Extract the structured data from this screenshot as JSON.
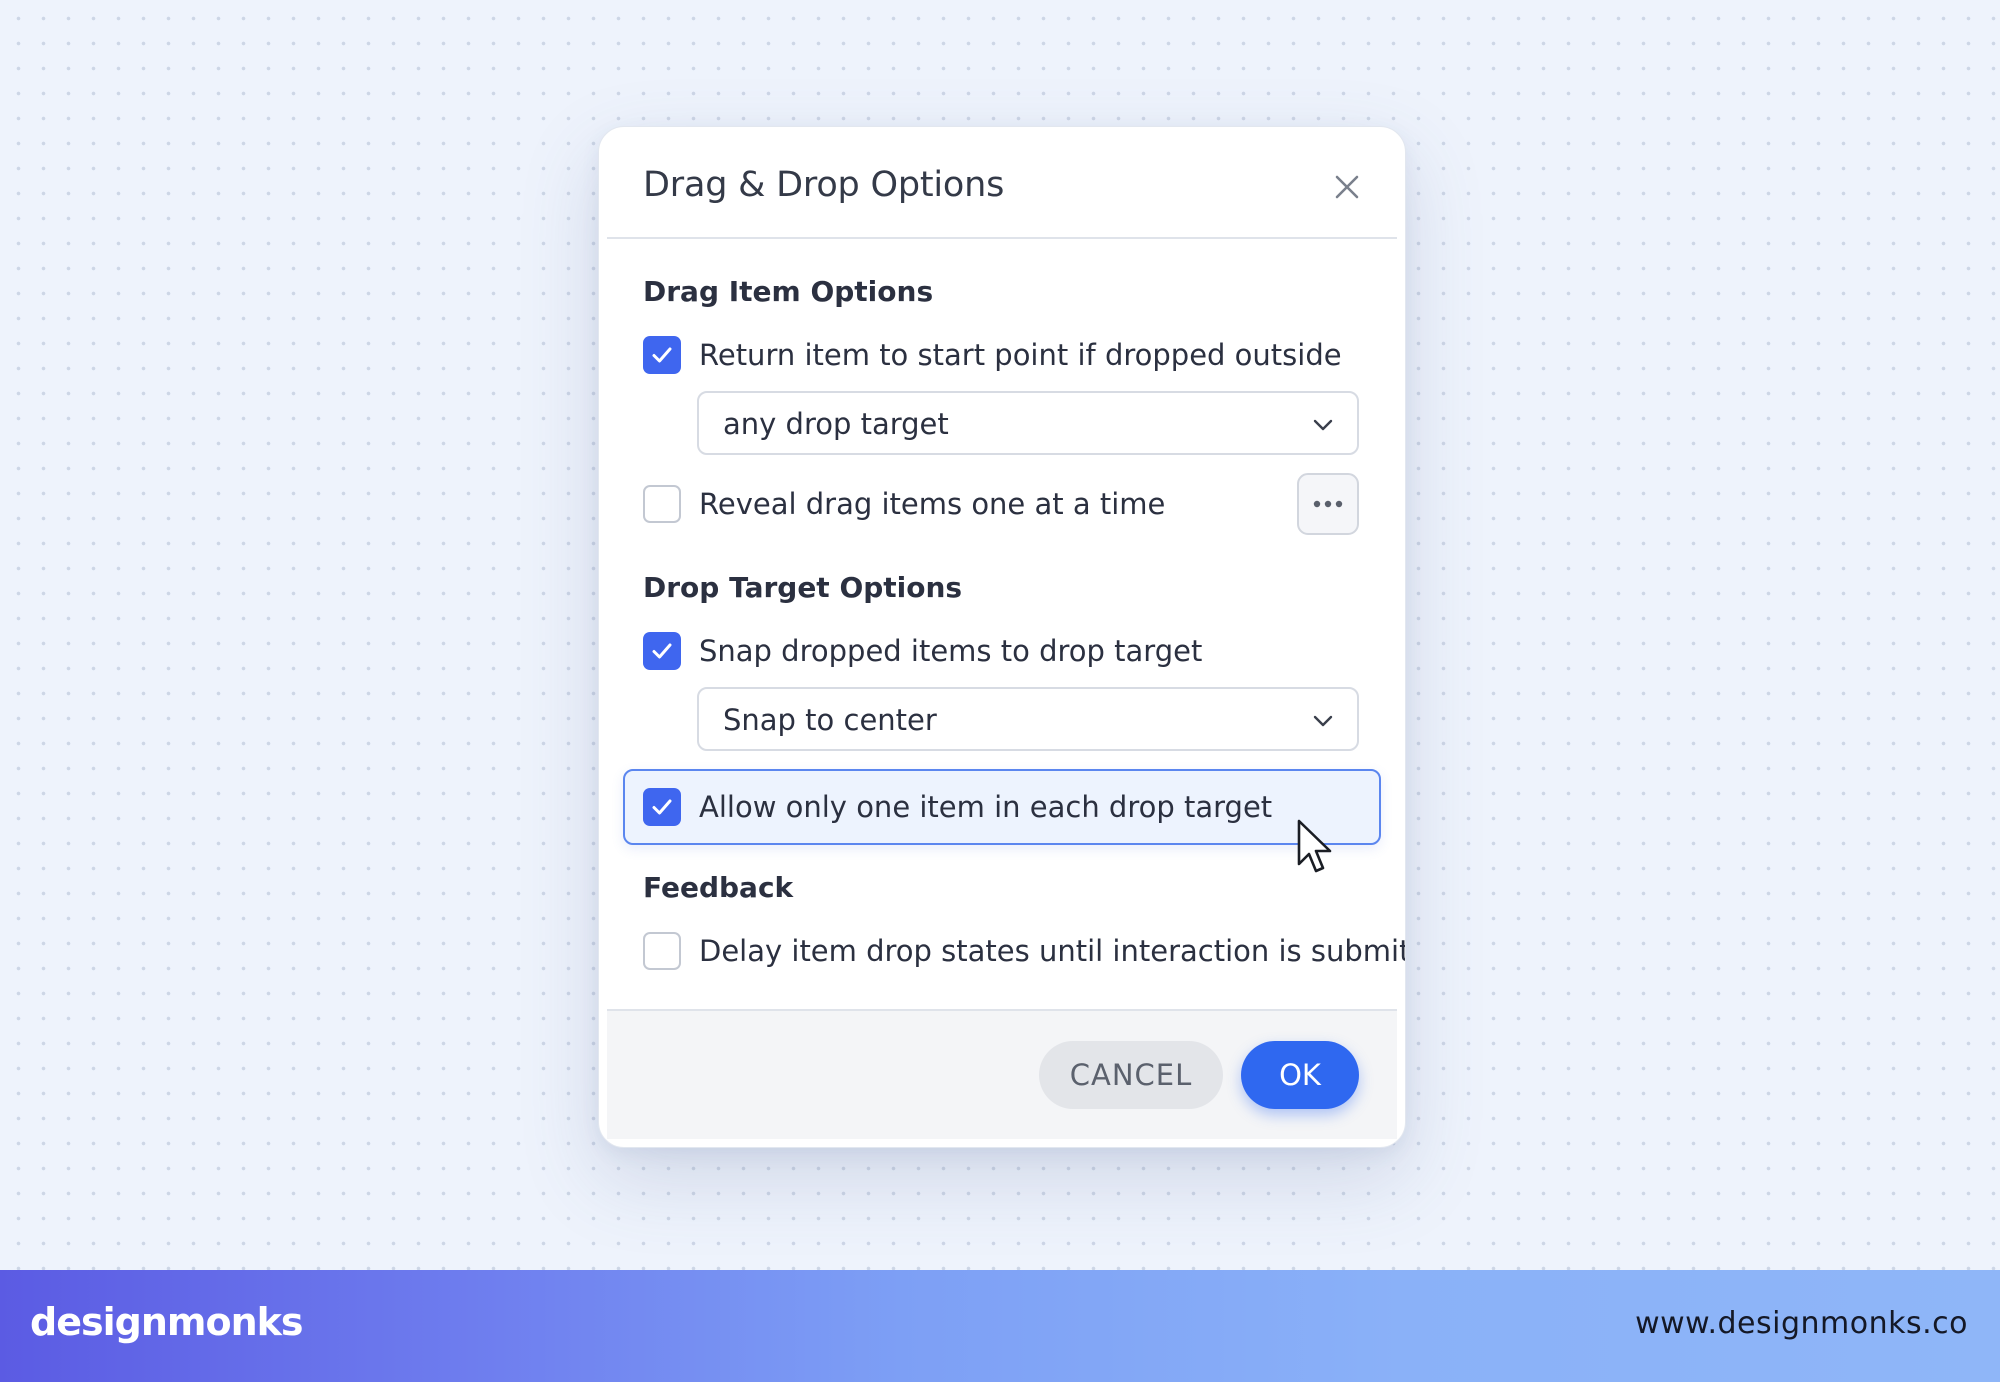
{
  "dialog": {
    "title": "Drag & Drop Options",
    "close_icon": "close-icon"
  },
  "sections": {
    "drag_item": {
      "heading": "Drag Item Options",
      "return_item": {
        "label": "Return item to start point if dropped outside",
        "checked": true
      },
      "return_target_select": {
        "value": "any drop target"
      },
      "reveal_items": {
        "label": "Reveal drag items one at a time",
        "checked": false,
        "more_icon": "more-horizontal-icon"
      }
    },
    "drop_target": {
      "heading": "Drop Target Options",
      "snap_items": {
        "label": "Snap dropped items to drop target",
        "checked": true
      },
      "snap_select": {
        "value": "Snap to center"
      },
      "one_item": {
        "label": "Allow only one item in each drop target",
        "checked": true
      }
    },
    "feedback": {
      "heading": "Feedback",
      "delay_states": {
        "label": "Delay item drop states until interaction is submitted",
        "checked": false
      }
    }
  },
  "footer": {
    "cancel_label": "CANCEL",
    "ok_label": "OK"
  },
  "branding": {
    "logo": "designmonks",
    "url": "www.designmonks.co"
  },
  "colors": {
    "accent": "#2f68f0",
    "checkbox_checked": "#3f66ef",
    "highlight_border": "#5b86ef",
    "highlight_bg": "#edf3fe",
    "page_bg": "#eef3fc"
  }
}
